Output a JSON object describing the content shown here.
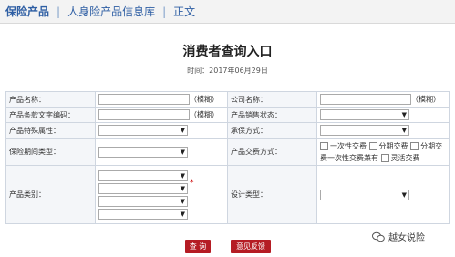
{
  "nav": {
    "items": [
      "保险产品",
      "人身险产品信息库",
      "正文"
    ],
    "separator": "|"
  },
  "page": {
    "title": "消费者查询入口",
    "time": "时间：2017年06月29日"
  },
  "form": {
    "product_name_label": "产品名称：",
    "company_name_label": "公司名称：",
    "fuzzy_hint": "（模糊）",
    "clause_code_label": "产品条款文字编码：",
    "sale_status_label": "产品销售状态：",
    "special_attr_label": "产品特殊属性：",
    "underwrite_label": "承保方式：",
    "period_type_label": "保险期间类型：",
    "payment_label": "产品交费方式：",
    "payment_options": [
      "一次性交费",
      "分期交费",
      "分期交费一次性交费兼有",
      "灵活交费"
    ],
    "category_label": "产品类别：",
    "design_label": "设计类型：",
    "required_mark": "*"
  },
  "buttons": {
    "query": "查 询",
    "feedback": "意见反馈"
  },
  "watermark": {
    "text": "越女说险"
  }
}
